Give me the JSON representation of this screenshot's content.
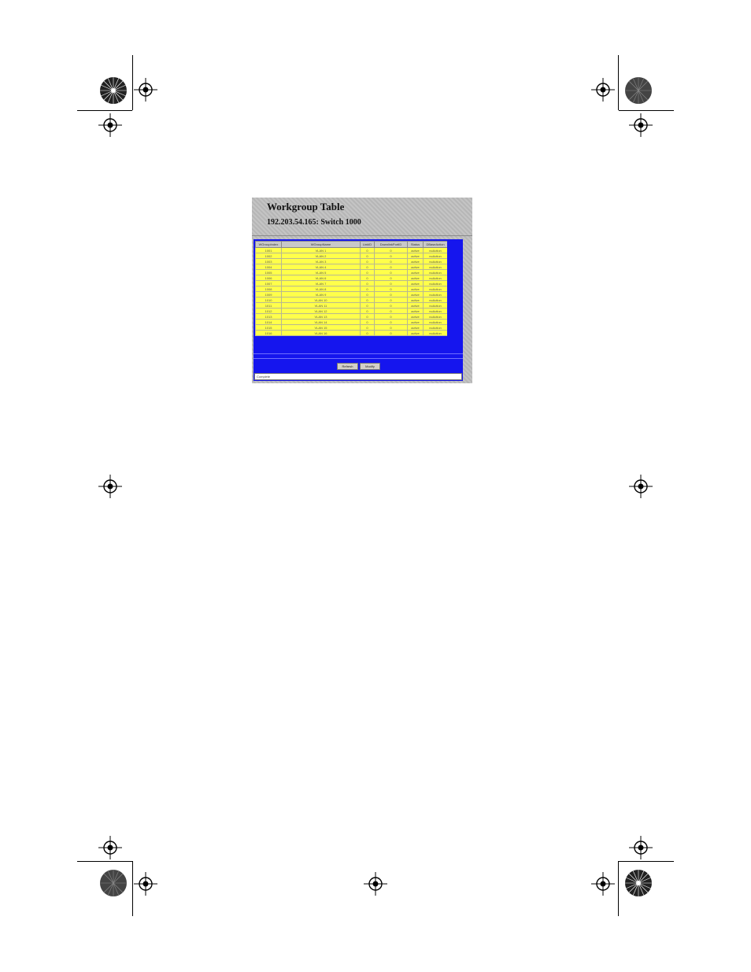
{
  "page": {
    "title": "Workgroup Table",
    "subtitle": "192.203.54.165: Switch 1000"
  },
  "table": {
    "columns": [
      "WGroupIndex",
      "WGroupName",
      "LinkID",
      "DownlinkPortID",
      "Status",
      "DBaseAction"
    ],
    "rows": [
      [
        "1001",
        "VLAN 1",
        "0",
        "0",
        "active",
        "noAction"
      ],
      [
        "1002",
        "VLAN 2",
        "0",
        "0",
        "active",
        "noAction"
      ],
      [
        "1003",
        "VLAN 3",
        "0",
        "0",
        "active",
        "noAction"
      ],
      [
        "1004",
        "VLAN 4",
        "0",
        "0",
        "active",
        "noAction"
      ],
      [
        "1005",
        "VLAN 5",
        "0",
        "0",
        "active",
        "noAction"
      ],
      [
        "1006",
        "VLAN 6",
        "0",
        "0",
        "active",
        "noAction"
      ],
      [
        "1007",
        "VLAN 7",
        "0",
        "0",
        "active",
        "noAction"
      ],
      [
        "1008",
        "VLAN 8",
        "0",
        "0",
        "active",
        "noAction"
      ],
      [
        "1009",
        "VLAN 9",
        "0",
        "0",
        "active",
        "noAction"
      ],
      [
        "1010",
        "VLAN 10",
        "0",
        "0",
        "active",
        "noAction"
      ],
      [
        "1011",
        "VLAN 11",
        "0",
        "0",
        "active",
        "noAction"
      ],
      [
        "1012",
        "VLAN 12",
        "0",
        "0",
        "active",
        "noAction"
      ],
      [
        "1013",
        "VLAN 13",
        "0",
        "0",
        "active",
        "noAction"
      ],
      [
        "1014",
        "VLAN 14",
        "0",
        "0",
        "active",
        "noAction"
      ],
      [
        "1015",
        "VLAN 15",
        "0",
        "0",
        "active",
        "noAction"
      ],
      [
        "1016",
        "VLAN 16",
        "0",
        "0",
        "active",
        "noAction"
      ]
    ]
  },
  "buttons": {
    "refresh": "Refresh",
    "modify": "Modify"
  },
  "status_bar": "Complete",
  "colors": {
    "frame": "#1515ee",
    "cell": "#ffff4a",
    "panel": "#bdbdbd"
  }
}
